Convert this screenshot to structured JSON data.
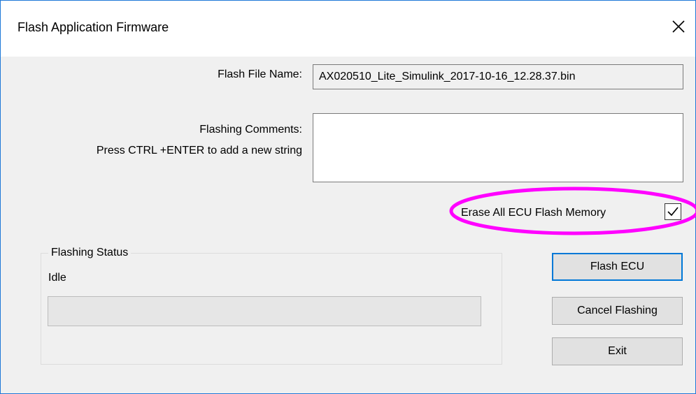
{
  "dialog": {
    "title": "Flash Application Firmware",
    "close_icon": "close-icon"
  },
  "form": {
    "file_name_label": "Flash File Name:",
    "file_name_value": "AX020510_Lite_Simulink_2017-10-16_12.28.37.bin",
    "comments_label": "Flashing Comments:",
    "comments_hint": "Press CTRL +ENTER to add a new string",
    "comments_value": "",
    "erase_label": "Erase All ECU Flash Memory",
    "erase_checked": true
  },
  "status": {
    "group_title": "Flashing Status",
    "state": "Idle",
    "progress_percent": 0
  },
  "buttons": {
    "flash": "Flash ECU",
    "cancel": "Cancel Flashing",
    "exit": "Exit"
  },
  "colors": {
    "accent": "#0078d7",
    "highlight_ellipse": "#ff00ff",
    "window_border": "#1e78d8"
  }
}
